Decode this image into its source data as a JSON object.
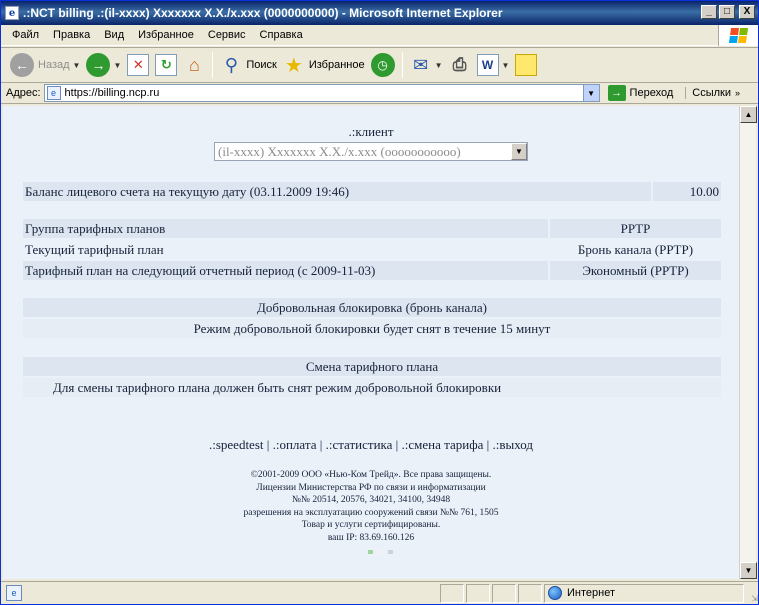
{
  "window": {
    "title": ".:NCT billing .:(il-xxxx) Xxxxxxx X.X./x.xxx (0000000000) - Microsoft Internet Explorer",
    "min_symbol": "_",
    "max_symbol": "□",
    "close_symbol": "X"
  },
  "menu": [
    "Файл",
    "Правка",
    "Вид",
    "Избранное",
    "Сервис",
    "Справка"
  ],
  "toolbar": {
    "back_label": "Назад",
    "search_label": "Поиск",
    "favorites_label": "Избранное"
  },
  "address": {
    "label": "Адрес:",
    "url": "https://billing.ncp.ru",
    "go_label": "Переход",
    "links_label": "Ссылки"
  },
  "page": {
    "client_label": ".:клиент",
    "client_selected": "(il-xxxx) Xxxxxxx X.X./x.xxx (ooooooooooo)",
    "balance": {
      "label": "Баланс лицевого счета на текущую дату (03.11.2009 19:46)",
      "value": "10.00"
    },
    "tariff_rows": [
      {
        "label": "Группа тарифных планов",
        "value": "PPTP"
      },
      {
        "label": "Текущий тарифный план",
        "value": "Бронь канала (PPTP)"
      },
      {
        "label": "Тарифный план на следующий отчетный период (с 2009-11-03)",
        "value": "Экономный (PPTP)"
      }
    ],
    "block_section": {
      "title": "Добровольная блокировка (бронь канала)",
      "text": "Режим добровольной блокировки будет снят в течение 15 минут"
    },
    "change_section": {
      "title": "Смена тарифного плана",
      "text": "Для смены тарифного плана должен быть снят режим добровольной блокировки"
    },
    "nav_links": [
      ".:speedtest",
      ".:оплата",
      ".:статистика",
      ".:смена тарифа",
      ".:выход"
    ],
    "nav_separator": "|",
    "footer_lines": [
      "©2001-2009 ООО «Нью-Ком Трейд». Все права защищены.",
      "Лицензии Министерства РФ по связи и информатизации",
      "№№ 20514, 20576, 34021, 34100, 34948",
      "разрешения на эксплуатацию сооружений связи №№ 761, 1505",
      "Товар и услуги сертифицированы.",
      "ваш IP: 83.69.160.126"
    ]
  },
  "status": {
    "zone_label": "Интернет"
  },
  "colors": {
    "page_bg": "#eaf1f9",
    "row_bg": "#dde6f0",
    "text": "#16223a",
    "dot1": "#9fd49f",
    "dot2": "#f2f2f2",
    "dot3": "#c9d3e0"
  }
}
